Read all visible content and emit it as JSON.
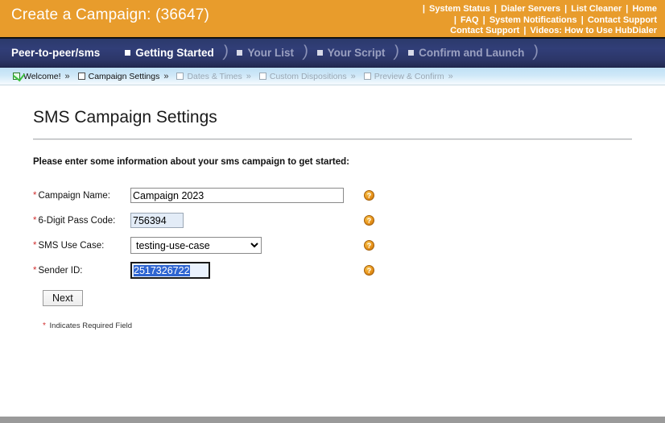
{
  "header": {
    "title": "Create a Campaign: (36647)",
    "links_rows": [
      [
        "|",
        "System Status",
        "|",
        "Dialer Servers",
        "|",
        "List Cleaner",
        "|",
        "Home"
      ],
      [
        "|",
        "FAQ",
        "|",
        "System Notifications",
        "|",
        "Contact Support"
      ],
      [
        "Contact Support",
        "|",
        "Videos: How to Use HubDialer"
      ]
    ]
  },
  "nav": {
    "brand": "Peer-to-peer/sms",
    "tabs": [
      {
        "label": "Getting Started",
        "active": true
      },
      {
        "label": "Your List",
        "active": false
      },
      {
        "label": "Your Script",
        "active": false
      },
      {
        "label": "Confirm and Launch",
        "active": false
      }
    ],
    "separator": ")"
  },
  "breadcrumbs": [
    {
      "label": "Welcome!",
      "state": "done",
      "chevron": "»"
    },
    {
      "label": "Campaign Settings",
      "state": "current",
      "chevron": "»"
    },
    {
      "label": "Dates & Times",
      "state": "dim",
      "chevron": "»"
    },
    {
      "label": "Custom Dispositions",
      "state": "dim",
      "chevron": "»"
    },
    {
      "label": "Preview & Confirm",
      "state": "dim",
      "chevron": "»"
    }
  ],
  "main": {
    "page_title": "SMS Campaign Settings",
    "intro": "Please enter some information about your sms campaign to get started:",
    "required_marker": "*",
    "fields": [
      {
        "label": "Campaign Name:",
        "type": "text",
        "value": "Campaign 2023",
        "placeholder": "",
        "help": "?"
      },
      {
        "label": "6-Digit Pass Code:",
        "type": "text",
        "value": "756394",
        "placeholder": "",
        "help": "?"
      },
      {
        "label": "SMS Use Case:",
        "type": "select",
        "value": "testing-use-case",
        "options": [
          "testing-use-case"
        ],
        "help": "?"
      },
      {
        "label": "Sender ID:",
        "type": "text",
        "value": "2517326722",
        "placeholder": "",
        "help": "?"
      }
    ],
    "next_label": "Next",
    "required_note": "Indicates Required Field"
  },
  "colors": {
    "brand_orange": "#e89c2c",
    "nav_navy": "#2f3b72",
    "crumb_blue": "#cfe8f8",
    "required_red": "#d03030",
    "help_orange": "#e8941c"
  }
}
